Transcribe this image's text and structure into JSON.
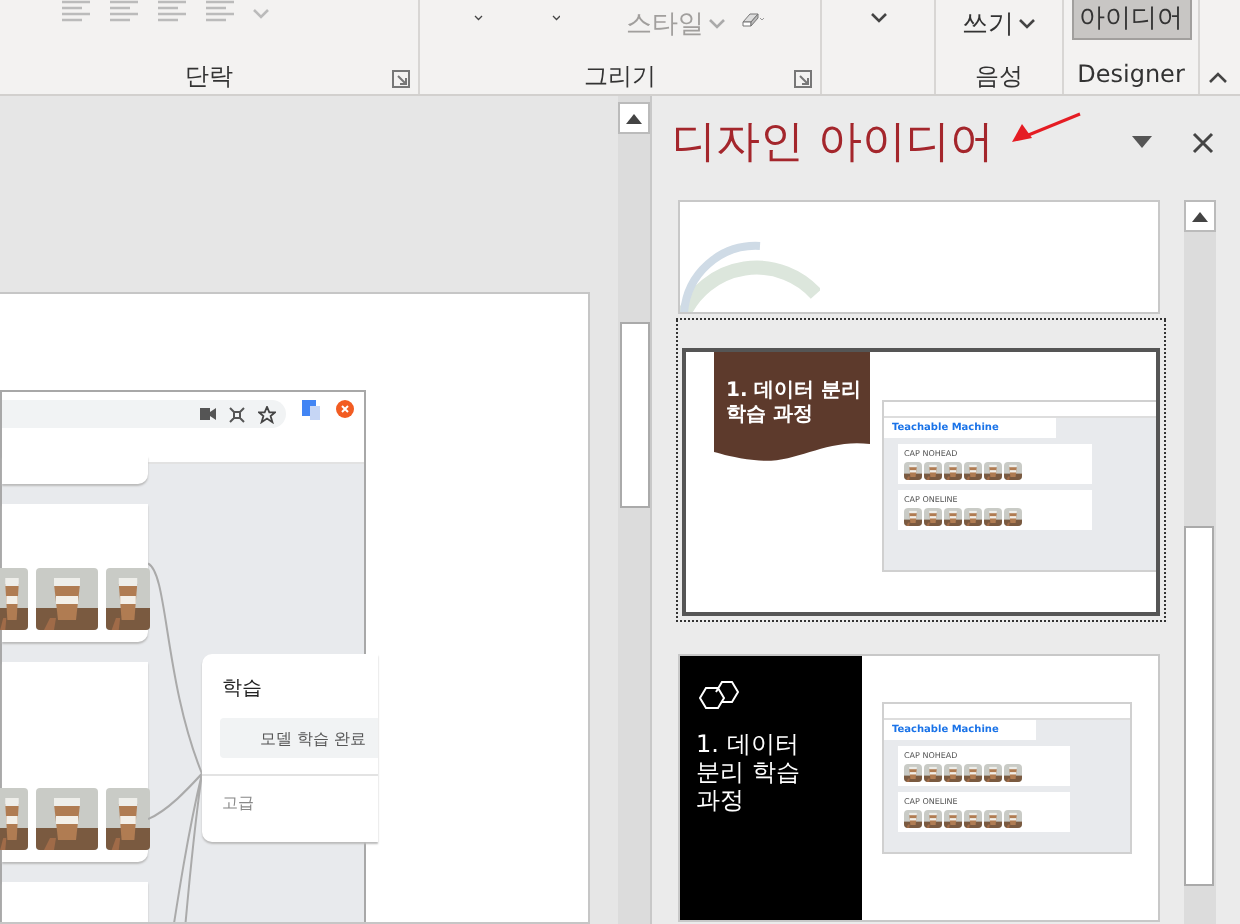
{
  "ribbon": {
    "groups": [
      {
        "kind": "paragraph",
        "label": "단락"
      },
      {
        "kind": "drawing",
        "label": "그리기",
        "items": [
          {
            "label": "스타일",
            "disabled": true
          }
        ]
      },
      {
        "kind": "blank"
      },
      {
        "kind": "voice",
        "label": "음성",
        "items": [
          {
            "label": "쓰기",
            "disabled": false
          }
        ]
      },
      {
        "kind": "designer",
        "label": "Designer",
        "items": [
          {
            "label": "아이디어",
            "selected": true
          }
        ]
      }
    ]
  },
  "slide": {
    "screenshot": {
      "panel_title": "학습",
      "train_button": "모델 학습 완료",
      "advanced": "고급"
    }
  },
  "designer_pane": {
    "title": "디자인 아이디어",
    "designs": [
      {
        "kind": "ring",
        "selected": false
      },
      {
        "kind": "banner",
        "selected": true,
        "title": "1. 데이터 분리 학습 과정",
        "app_title": "Teachable Machine",
        "class_names": [
          "CAP NOHEAD",
          "CAP ONELINE"
        ]
      },
      {
        "kind": "dark",
        "selected": false,
        "title": "1. 데이터 분리 학습 과정",
        "app_title": "Teachable Machine",
        "class_names": [
          "CAP NOHEAD",
          "CAP ONELINE"
        ]
      }
    ]
  }
}
